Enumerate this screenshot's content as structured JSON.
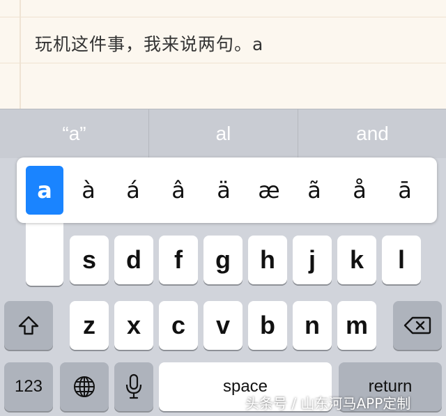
{
  "editor": {
    "text": "玩机这件事，我来说两句。a"
  },
  "suggestions": [
    "“a”",
    "al",
    "and"
  ],
  "accent_popup": {
    "selected": "a",
    "variants": [
      "à",
      "á",
      "â",
      "ä",
      "æ",
      "ã",
      "å",
      "ā"
    ]
  },
  "keyboard": {
    "row2_letters": [
      "s",
      "d",
      "f",
      "g",
      "h",
      "j",
      "k",
      "l"
    ],
    "row3_letters": [
      "z",
      "x",
      "c",
      "v",
      "b",
      "n",
      "m"
    ],
    "shift_icon": "shift-arrow-icon",
    "backspace_icon": "backspace-icon",
    "numbers_label": "123",
    "globe_icon": "globe-icon",
    "mic_icon": "microphone-icon",
    "space_label": "space",
    "return_label": "return"
  },
  "watermark": "头条号 / 山东河马APP定制",
  "colors": {
    "accent": "#1a84ff",
    "keyboard_bg": "#d1d4db",
    "editor_bg": "#fcf7ef"
  }
}
